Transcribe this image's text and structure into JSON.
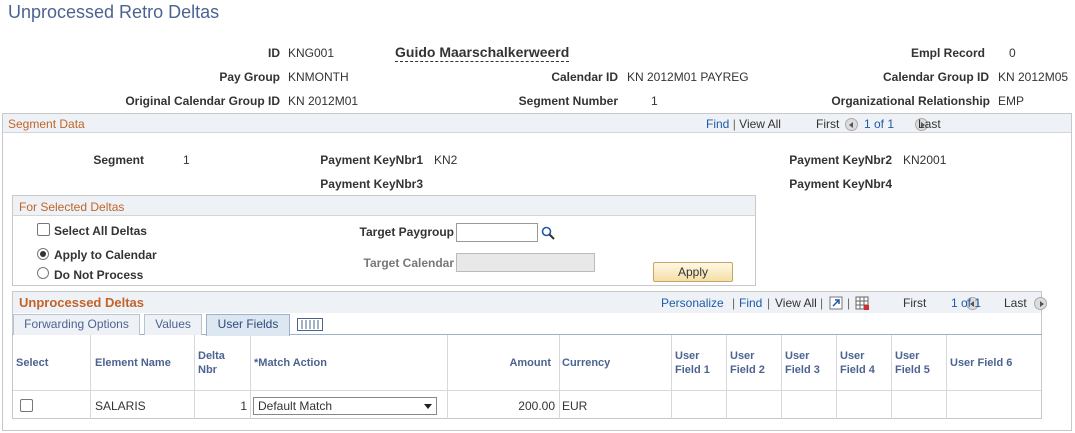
{
  "page": {
    "title": "Unprocessed Retro Deltas"
  },
  "header": {
    "id_label": "ID",
    "id_value": "KNG001",
    "emp_name": "Guido Maarschalkerweerd",
    "empl_record_label": "Empl Record",
    "empl_record_value": "0",
    "pay_group_label": "Pay Group",
    "pay_group_value": "KNMONTH",
    "calendar_id_label": "Calendar ID",
    "calendar_id_value": "KN 2012M01 PAYREG",
    "calendar_group_id_label": "Calendar Group ID",
    "calendar_group_id_value": "KN 2012M05",
    "orig_cal_group_label": "Original Calendar Group ID",
    "orig_cal_group_value": "KN 2012M01",
    "segment_number_label": "Segment Number",
    "segment_number_value": "1",
    "org_rel_label": "Organizational Relationship",
    "org_rel_value": "EMP"
  },
  "segment": {
    "title": "Segment Data",
    "nav": {
      "find": "Find",
      "sep": "|",
      "view_all": "View All",
      "first": "First",
      "range": "1 of 1",
      "last": "Last"
    },
    "segment_label": "Segment",
    "segment_value": "1",
    "key1_label": "Payment KeyNbr1",
    "key1_value": "KN2",
    "key2_label": "Payment KeyNbr2",
    "key2_value": "KN2001",
    "key3_label": "Payment KeyNbr3",
    "key4_label": "Payment KeyNbr4"
  },
  "selected": {
    "title": "For Selected Deltas",
    "select_all_label": "Select All Deltas",
    "apply_calendar_label": "Apply to Calendar",
    "do_not_process_label": "Do Not Process",
    "target_paygroup_label": "Target Paygroup",
    "target_paygroup_value": "",
    "target_calendar_label": "Target Calendar",
    "target_calendar_value": "",
    "apply_button": "Apply"
  },
  "grid": {
    "title": "Unprocessed Deltas",
    "nav": {
      "personalize": "Personalize",
      "find": "Find",
      "view_all": "View All",
      "sep": "|",
      "first": "First",
      "range": "1 of 1",
      "last": "Last"
    },
    "tabs": [
      "Forwarding Options",
      "Values",
      "User Fields"
    ],
    "active_tab": "User Fields",
    "columns": {
      "select": "Select",
      "element": "Element Name",
      "delta1": "Delta",
      "delta2": "Nbr",
      "match": "*Match Action",
      "amount": "Amount",
      "currency": "Currency",
      "uf1a": "User",
      "uf1b": "Field 1",
      "uf2a": "User",
      "uf2b": "Field 2",
      "uf3a": "User",
      "uf3b": "Field 3",
      "uf4a": "User",
      "uf4b": "Field 4",
      "uf5a": "User",
      "uf5b": "Field 5",
      "uf6": "User Field 6"
    },
    "rows": [
      {
        "element": "SALARIS",
        "delta_nbr": "1",
        "match_action": "Default Match",
        "amount": "200.00",
        "currency": "EUR"
      }
    ]
  },
  "colors": {
    "accent": "#4c6391",
    "section_title": "#c0642a",
    "link": "#1e5aa8",
    "header_bg": "#eef2f6"
  }
}
